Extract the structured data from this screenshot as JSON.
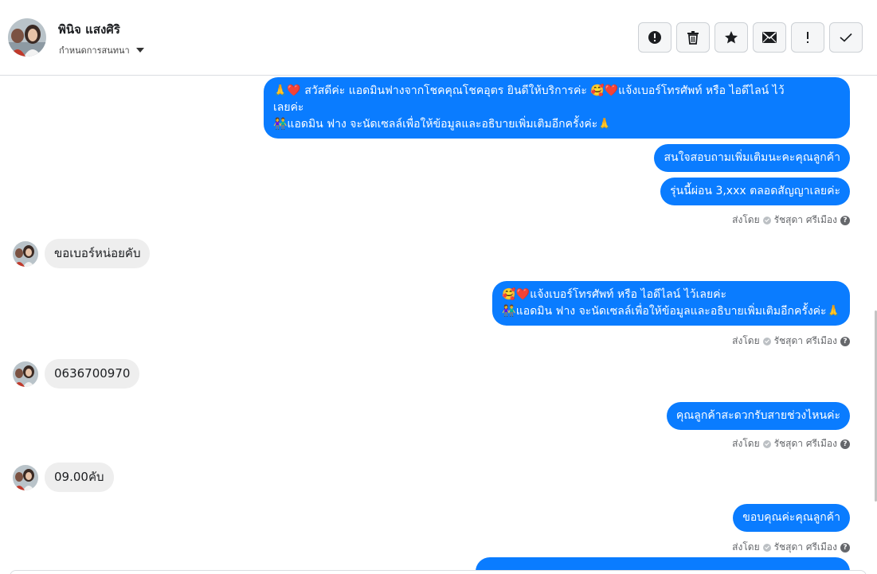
{
  "header": {
    "contact_name": "พินิจ แสงศิริ",
    "assign_label": "กำหนดการสนทนา",
    "toolbar": {
      "icons": [
        "alert-circle-icon",
        "trash-icon",
        "star-icon",
        "envelope-icon",
        "exclamation-icon",
        "check-icon"
      ]
    }
  },
  "messages": {
    "m1_line1": "🙏❤️ สวัสดีค่ะ แอดมินฟางจากโชคคุณโชคอุตร ยินดีให้บริการค่ะ 🥰❤️แจ้งเบอร์โทรศัพท์ หรือ ไอดีไลน์  ไว้",
    "m1_line2": "เลยค่ะ",
    "m1_line3": "👫แอดมิน ฟาง จะนัดเซลล์เพื่อให้ข้อมูลและอธิบายเพิ่มเติมอีกครั้งค่ะ🙏",
    "m2": "สนใจสอบถามเพิ่มเติมนะคะคุณลูกค้า",
    "m3": "รุ่นนี้ผ่อน 3,xxx ตลอดสัญญาเลยค่ะ",
    "sent_by_prefix": "ส่งโดย",
    "sent_by_name": "รัชสุดา ศรีเมือง",
    "help_glyph": "?",
    "m4": "ขอเบอร์หน่อยคับ",
    "m5_line1": "🥰❤️แจ้งเบอร์โทรศัพท์ หรือ ไอดีไลน์  ไว้เลยค่ะ",
    "m5_line2": "👫แอดมิน ฟาง จะนัดเซลล์เพื่อให้ข้อมูลและอธิบายเพิ่มเติมอีกครั้งค่ะ🙏",
    "m6": "0636700970",
    "m7": "คุณลูกค้าสะดวกรับสายช่วงไหนค่ะ",
    "m8": "09.00คับ",
    "m9": "ขอบคุณค่ะคุณลูกค้า"
  },
  "colors": {
    "outgoing_bubble": "#0a7cff",
    "incoming_bubble": "#eeeeee",
    "meta_text": "#65676b"
  }
}
